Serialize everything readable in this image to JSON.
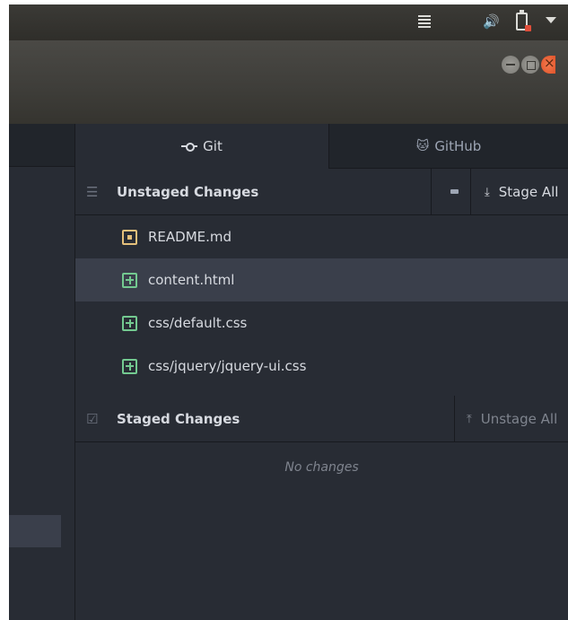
{
  "system_bar": {
    "icons": [
      "menu-icon",
      "volume-icon",
      "battery-icon",
      "chevron-down-icon"
    ]
  },
  "window": {
    "controls": [
      "minimize-button",
      "maximize-button",
      "close-button"
    ]
  },
  "tabs": [
    {
      "label": "Git",
      "icon": "git-commit-icon",
      "active": true
    },
    {
      "label": "GitHub",
      "icon": "octocat-icon",
      "active": false
    }
  ],
  "unstaged": {
    "title": "Unstaged Changes",
    "action_label": "Stage All",
    "files": [
      {
        "name": "README.md",
        "status": "modified"
      },
      {
        "name": "content.html",
        "status": "added",
        "selected": true
      },
      {
        "name": "css/default.css",
        "status": "added"
      },
      {
        "name": "css/jquery/jquery-ui.css",
        "status": "added"
      }
    ]
  },
  "staged": {
    "title": "Staged Changes",
    "action_label": "Unstage All",
    "empty_text": "No changes"
  },
  "colors": {
    "background": "#282c34",
    "modified": "#e5c07b",
    "added": "#73c990",
    "selection": "#3a3f4b"
  }
}
